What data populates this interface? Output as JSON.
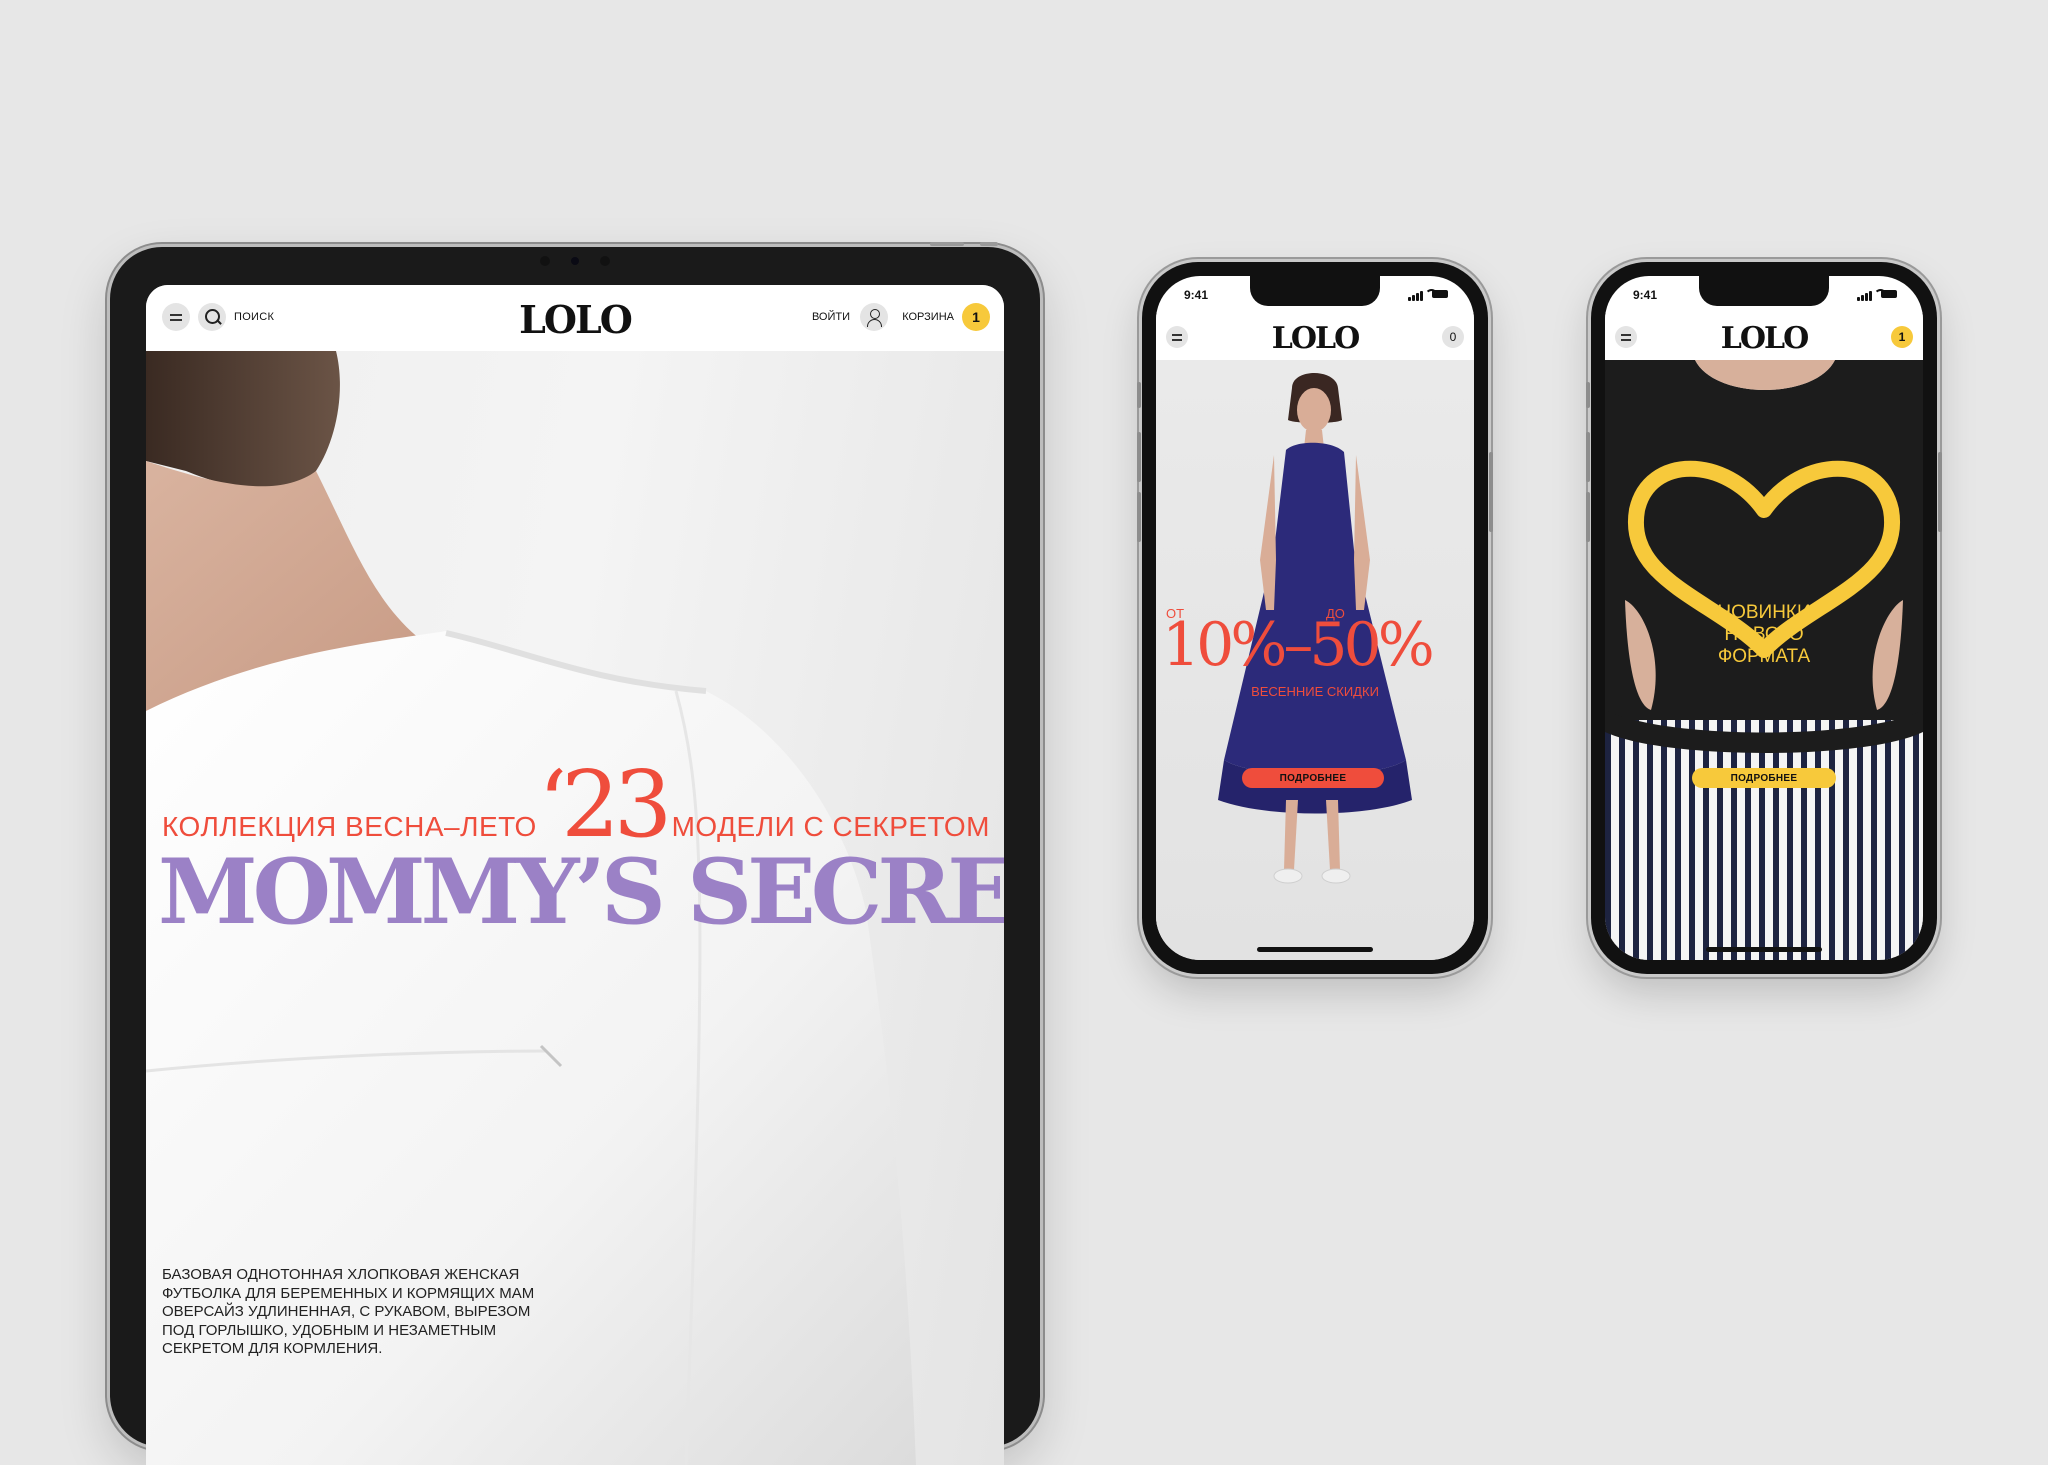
{
  "brand": {
    "logo": "LOLO"
  },
  "colors": {
    "background": "#e7e7e7",
    "coral": "#ef4d3c",
    "lavender": "#9b81c6",
    "yellow": "#f7c93b"
  },
  "tablet": {
    "header": {
      "search_label": "ПОИСК",
      "login_label": "ВОЙТИ",
      "cart_label": "КОРЗИНА",
      "cart_count": "1"
    },
    "hero": {
      "season_label": "КОЛЛЕКЦИЯ ВЕСНА–ЛЕТО",
      "year": "‘23",
      "secret_label": "МОДЕЛИ С СЕКРЕТОМ",
      "title": "MOMMY’S SECRET",
      "description": "БАЗОВАЯ ОДНОТОННАЯ ХЛОПКОВАЯ ЖЕНСКАЯ ФУТБОЛКА ДЛЯ БЕРЕМЕННЫХ И КОРМЯЩИХ МАМ ОВЕРСАЙЗ УДЛИНЕННАЯ, С РУКАВОМ, ВЫРЕЗОМ ПОД ГОРЛЫШКО, УДОБНЫМ И НЕЗАМЕТНЫМ СЕКРЕТОМ ДЛЯ КОРМЛЕНИЯ."
    }
  },
  "phone_sale": {
    "status_time": "9:41",
    "cart_count": "0",
    "hero": {
      "from_label": "ОТ",
      "to_label": "ДО",
      "discount": "10%–50%",
      "subtitle": "ВЕСЕННИЕ СКИДКИ",
      "button": "ПОДРОБНЕЕ"
    }
  },
  "phone_new": {
    "status_time": "9:41",
    "cart_count": "1",
    "hero": {
      "heading_line1": "НОВИНКИ",
      "heading_line2": "НОВОГО",
      "heading_line3": "ФОРМАТА",
      "button": "ПОДРОБНЕЕ"
    }
  }
}
